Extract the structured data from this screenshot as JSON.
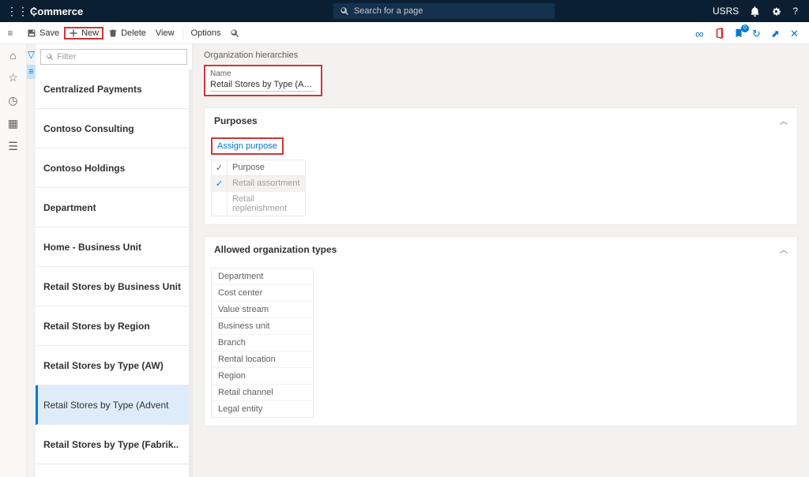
{
  "topbar": {
    "app_title": "Commerce",
    "search_placeholder": "Search for a page",
    "user": "USRS"
  },
  "cmdbar": {
    "save": "Save",
    "new": "New",
    "delete": "Delete",
    "view": "View",
    "options": "Options",
    "attachments_count": "0"
  },
  "list": {
    "filter_placeholder": "Filter",
    "items": [
      "Centralized Payments",
      "Contoso Consulting",
      "Contoso Holdings",
      "Department",
      "Home - Business Unit",
      "Retail Stores by Business Unit",
      "Retail Stores by Region",
      "Retail Stores by Type (AW)",
      "Retail Stores by Type (Advent",
      "Retail Stores by Type (Fabrik.."
    ],
    "selected_index": 8
  },
  "main": {
    "breadcrumb": "Organization hierarchies",
    "name_label": "Name",
    "name_value": "Retail Stores by Type (Adventur...",
    "purposes": {
      "header": "Purposes",
      "assign_label": "Assign purpose",
      "col_header": "Purpose",
      "rows": [
        {
          "label": "Retail assortment",
          "checked": true
        },
        {
          "label": "Retail replenishment",
          "checked": false
        }
      ]
    },
    "org_types": {
      "header": "Allowed organization types",
      "rows": [
        "Department",
        "Cost center",
        "Value stream",
        "Business unit",
        "Branch",
        "Rental location",
        "Region",
        "Retail channel",
        "Legal entity"
      ]
    }
  }
}
